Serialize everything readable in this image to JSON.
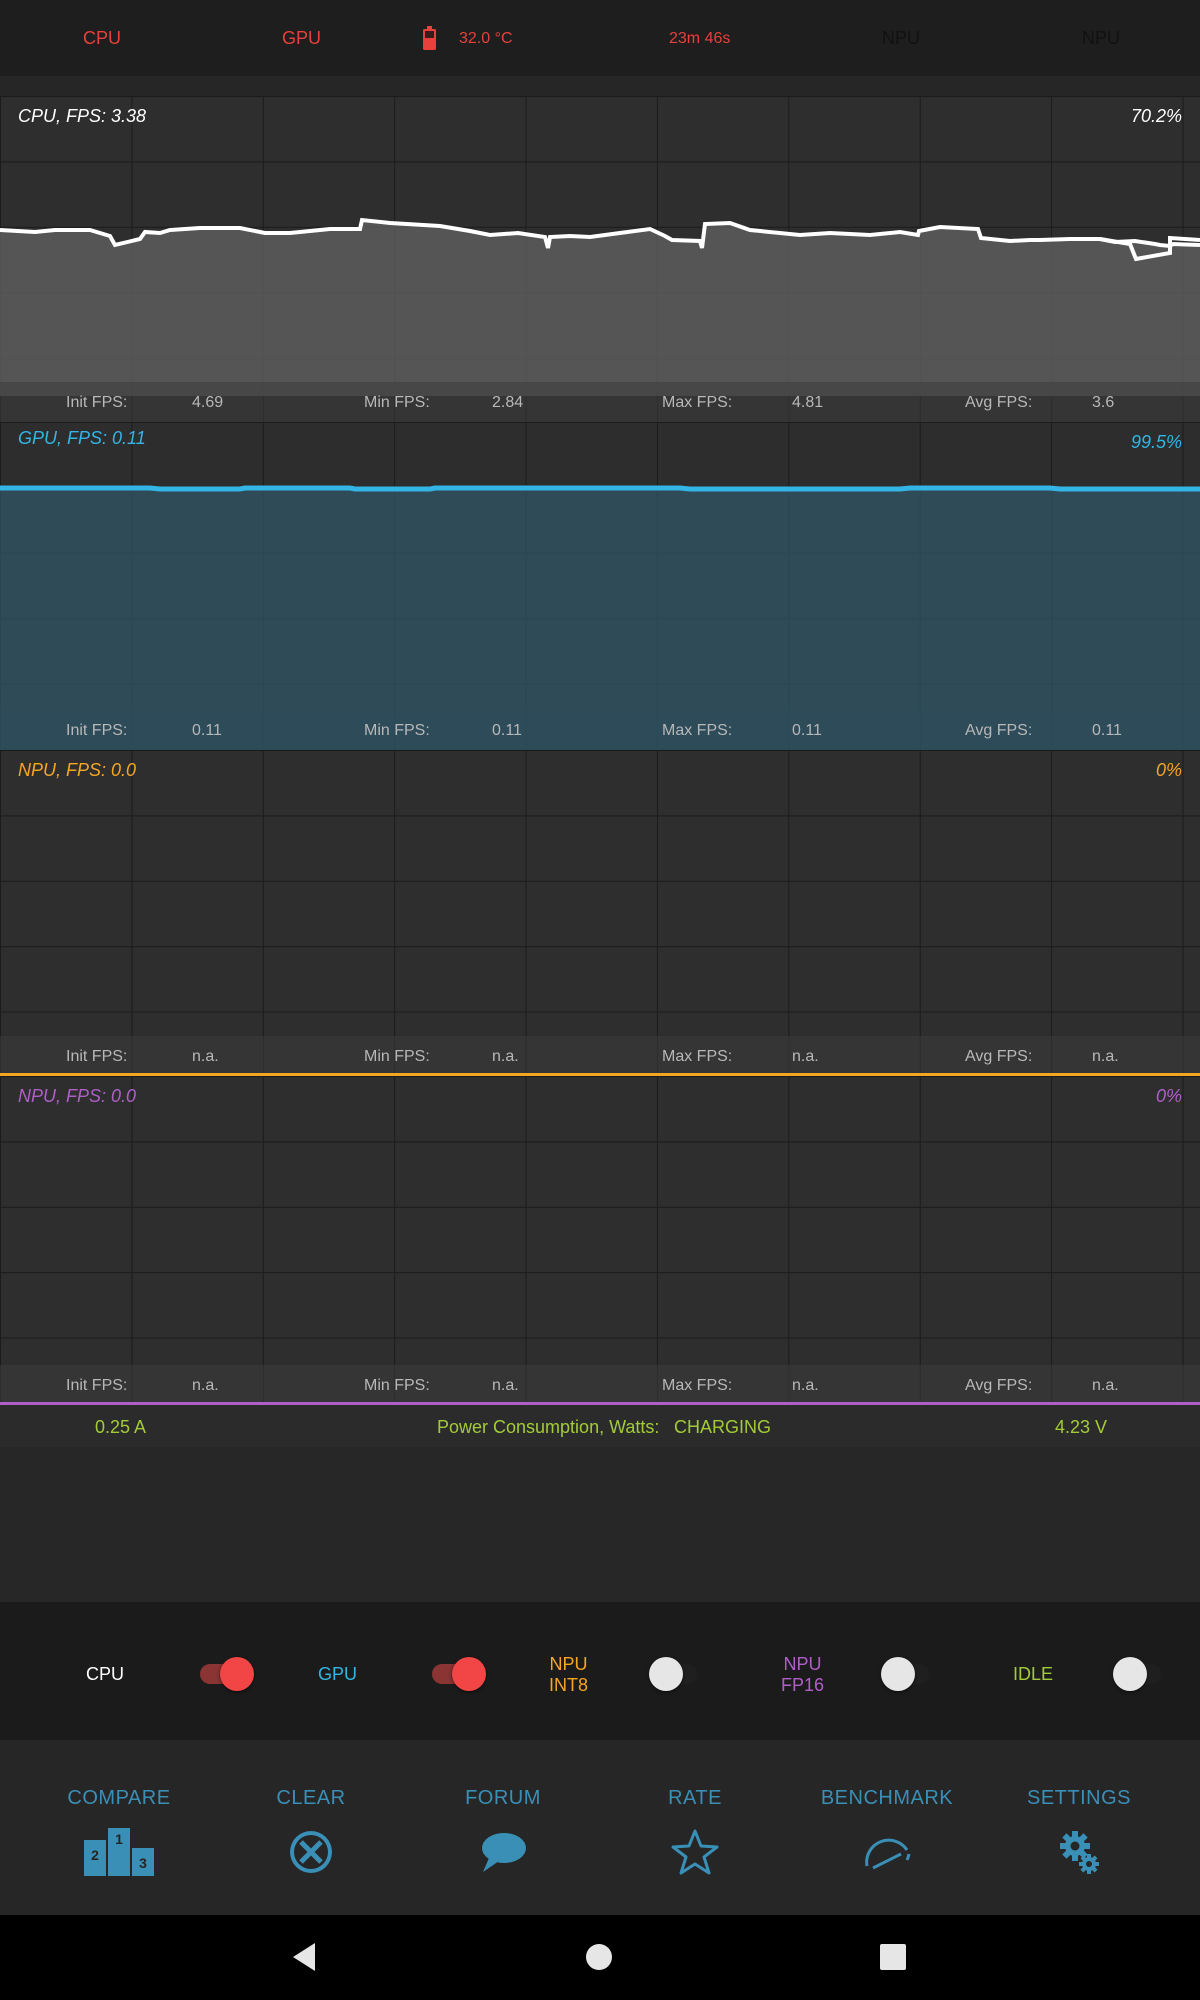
{
  "topbar": {
    "cpu": "CPU",
    "gpu": "GPU",
    "temperature": "32.0 °C",
    "elapsed": "23m 46s",
    "npu1": "NPU",
    "npu2": "NPU"
  },
  "panels": {
    "cpu": {
      "title": "CPU, FPS:  3.38",
      "percent": "70.2%",
      "stats": {
        "init_label": "Init FPS:",
        "init": "4.69",
        "min_label": "Min FPS:",
        "min": "2.84",
        "max_label": "Max FPS:",
        "max": "4.81",
        "avg_label": "Avg FPS:",
        "avg": "3.6"
      }
    },
    "gpu": {
      "title": "GPU, FPS:  0.11",
      "percent": "99.5%",
      "stats": {
        "init_label": "Init FPS:",
        "init": "0.11",
        "min_label": "Min FPS:",
        "min": "0.11",
        "max_label": "Max FPS:",
        "max": "0.11",
        "avg_label": "Avg FPS:",
        "avg": "0.11"
      }
    },
    "npu_int8": {
      "title": "NPU, FPS:  0.0",
      "percent": "0%",
      "stats": {
        "init_label": "Init FPS:",
        "init": "n.a.",
        "min_label": "Min FPS:",
        "min": "n.a.",
        "max_label": "Max FPS:",
        "max": "n.a.",
        "avg_label": "Avg FPS:",
        "avg": "n.a."
      }
    },
    "npu_fp16": {
      "title": "NPU, FPS:  0.0",
      "percent": "0%",
      "stats": {
        "init_label": "Init FPS:",
        "init": "n.a.",
        "min_label": "Min FPS:",
        "min": "n.a.",
        "max_label": "Max FPS:",
        "max": "n.a.",
        "avg_label": "Avg FPS:",
        "avg": "n.a."
      }
    }
  },
  "power": {
    "current": "0.25 A",
    "label": "Power Consumption, Watts:",
    "status": "CHARGING",
    "voltage": "4.23 V"
  },
  "toggles": [
    {
      "label": "CPU",
      "state": "on"
    },
    {
      "label": "GPU",
      "state": "on"
    },
    {
      "label_line1": "NPU",
      "label_line2": "INT8",
      "state": "off"
    },
    {
      "label_line1": "NPU",
      "label_line2": "FP16",
      "state": "off"
    },
    {
      "label": "IDLE",
      "state": "off"
    }
  ],
  "actions": {
    "compare": "COMPARE",
    "clear": "CLEAR",
    "forum": "FORUM",
    "rate": "RATE",
    "benchmark": "BENCHMARK",
    "settings": "SETTINGS"
  },
  "colors": {
    "cpu": "#ffffff",
    "gpu": "#33b5e5",
    "npu_int8": "#f5a623",
    "npu_fp16": "#b05fc9",
    "power": "#a3cb38",
    "alert": "#e8403a",
    "accent": "#3a8fb7"
  },
  "icons": {
    "compare": "podium-icon",
    "clear": "circle-x-icon",
    "forum": "speech-bubble-icon",
    "rate": "star-icon",
    "benchmark": "speedometer-icon",
    "settings": "gears-icon",
    "battery": "battery-icon",
    "nav_back": "back-triangle-icon",
    "nav_home": "home-circle-icon",
    "nav_recents": "recents-square-icon"
  }
}
